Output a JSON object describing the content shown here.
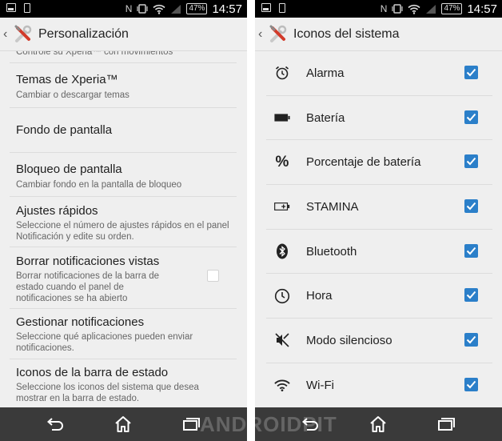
{
  "status_bar": {
    "battery_percent": "47%",
    "time": "14:57",
    "nfc_glyph": "N"
  },
  "left": {
    "title": "Personalización",
    "partial_top_text": "Controle su Xperia™ con movimientos",
    "items": [
      {
        "title": "Temas de Xperia™",
        "subtitle": "Cambiar o descargar temas"
      },
      {
        "title": "Fondo de pantalla",
        "subtitle": ""
      },
      {
        "title": "Bloqueo de pantalla",
        "subtitle": "Cambiar fondo en la pantalla de bloqueo"
      },
      {
        "title": "Ajustes rápidos",
        "subtitle": "Seleccione el número de ajustes rápidos en el panel Notificación y edite su orden."
      },
      {
        "title": "Borrar notificaciones vistas",
        "subtitle": "Borrar notificaciones de la barra de estado cuando el panel de notificaciones se ha abierto",
        "checked": false
      },
      {
        "title": "Gestionar notificaciones",
        "subtitle": "Seleccione qué aplicaciones pueden enviar notificaciones."
      },
      {
        "title": "Iconos de la barra de estado",
        "subtitle": "Seleccione los iconos del sistema que desea mostrar en la barra de estado."
      }
    ]
  },
  "right": {
    "title": "Iconos del sistema",
    "items": [
      {
        "label": "Alarma",
        "icon": "alarm-icon",
        "checked": true
      },
      {
        "label": "Batería",
        "icon": "battery-icon",
        "checked": true
      },
      {
        "label": "Porcentaje de batería",
        "icon": "percent-icon",
        "checked": true
      },
      {
        "label": "STAMINA",
        "icon": "stamina-icon",
        "checked": true
      },
      {
        "label": "Bluetooth",
        "icon": "bluetooth-icon",
        "checked": true
      },
      {
        "label": "Hora",
        "icon": "clock-icon",
        "checked": true
      },
      {
        "label": "Modo silencioso",
        "icon": "silent-mode-icon",
        "checked": true
      },
      {
        "label": "Wi-Fi",
        "icon": "wifi-icon",
        "checked": true
      }
    ]
  },
  "watermark": "ANDROIDPIT",
  "colors": {
    "checkbox_checked": "#2b7fc9",
    "status_bar": "#000000",
    "nav_bar": "#3a3a3a",
    "background": "#efefef"
  }
}
